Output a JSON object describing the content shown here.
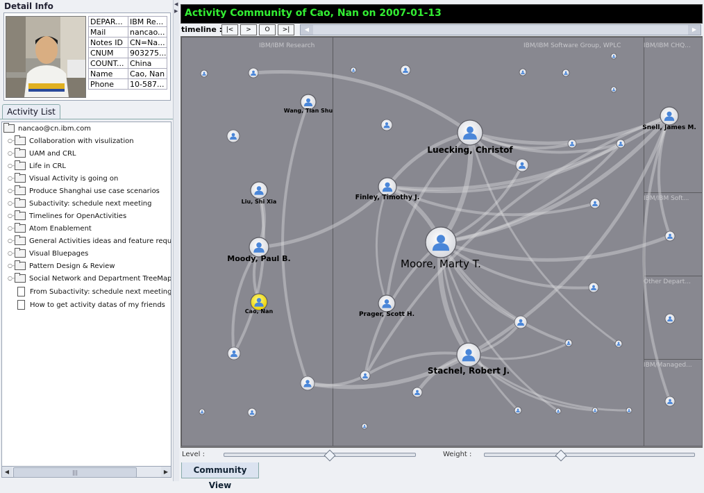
{
  "detail": {
    "title": "Detail Info",
    "rows": [
      {
        "key": "DEPAR...",
        "value": "IBM Re..."
      },
      {
        "key": "Mail",
        "value": "nancao..."
      },
      {
        "key": "Notes ID",
        "value": "CN=Na..."
      },
      {
        "key": "CNUM",
        "value": "903275..."
      },
      {
        "key": "COUNT...",
        "value": "China"
      },
      {
        "key": "Name",
        "value": "Cao, Nan"
      },
      {
        "key": "Phone",
        "value": "10-587..."
      }
    ]
  },
  "activity_list": {
    "tab_label": "Activity List",
    "root": "nancao@cn.ibm.com",
    "folders": [
      "Collaboration with visulization",
      "UAM and CRL",
      "Life in CRL",
      "Visual Activity is going on",
      "Produce Shanghai use case scenarios",
      "Subactivity: schedule next meeting",
      "Timelines for OpenActivities",
      "Atom Enablement",
      "General Activities ideas and feature requests",
      "Visual Bluepages",
      "Pattern Design & Review",
      "Social Network and Department TreeMap demo"
    ],
    "documents": [
      "From Subactivity: schedule next meeting",
      "How to get activity datas of my friends"
    ]
  },
  "community": {
    "title": "Activity Community of Cao, Nan on 2007-01-13",
    "timeline_label": "timeline :",
    "timeline_buttons": [
      "|<",
      ">",
      "O",
      ">|"
    ],
    "groups": [
      "IBM/IBM Research",
      "IBM/IBM Software Group, WPLC",
      "IBM/IBM CHQ...",
      "IBM/IBM Soft...",
      "Other Depart...",
      "IBM/Managed..."
    ],
    "people": [
      {
        "name": "Moore, Marty T."
      },
      {
        "name": "Luecking, Christof"
      },
      {
        "name": "Stachel, Robert J."
      },
      {
        "name": "Moody, Paul B."
      },
      {
        "name": "Finley, Timothy J."
      },
      {
        "name": "Prager, Scott H."
      },
      {
        "name": "Wang, Tian Shu"
      },
      {
        "name": "Liu, Shi Xia"
      },
      {
        "name": "Cao, Nan"
      },
      {
        "name": "Snell, James M."
      }
    ],
    "level_label": "Level :",
    "weight_label": "Weight :",
    "level_value": 0.55,
    "weight_value": 0.36,
    "view_tab": "Community View",
    "colors": {
      "title_text": "#33ee33",
      "title_bg": "#000000",
      "canvas_bg": "#888890",
      "person_icon": "#4a86d8",
      "selected_person": "#ffee00",
      "edge": "#d8d8da"
    }
  }
}
